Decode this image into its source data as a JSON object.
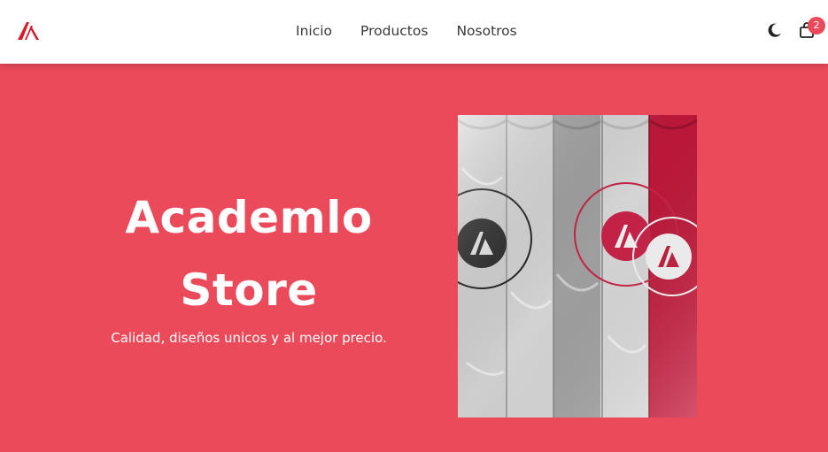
{
  "header": {
    "logo_icon": "academlo-logo-icon",
    "nav": [
      {
        "label": "Inicio"
      },
      {
        "label": "Productos"
      },
      {
        "label": "Nosotros"
      }
    ],
    "theme_toggle_icon": "moon-icon",
    "cart_icon": "shopping-bag-icon",
    "cart_count": "2"
  },
  "hero": {
    "title_line1": "Academlo",
    "title_line2": "Store",
    "subtitle": "Calidad, diseños unicos y al mejor precio."
  },
  "colors": {
    "accent": "#ea4a5a",
    "header_bg": "#ffffff",
    "nav_text": "#3a3a3a",
    "shirt_dark_red": "#c7193c",
    "shirt_gray": "#a9a9a9"
  }
}
